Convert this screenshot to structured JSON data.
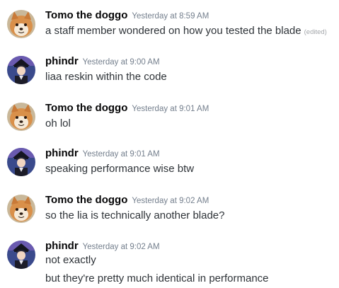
{
  "messages": [
    {
      "username": "Tomo the doggo",
      "timestamp": "Yesterday at 8:59 AM",
      "avatar": "shiba-dog-avatar",
      "lines": [
        "a staff member wondered on how you tested the blade"
      ],
      "edited_label": "(edited)"
    },
    {
      "username": "phindr",
      "timestamp": "Yesterday at 9:00 AM",
      "avatar": "anime-character-avatar",
      "lines": [
        "liaa reskin within the code"
      ]
    },
    {
      "username": "Tomo the doggo",
      "timestamp": "Yesterday at 9:01 AM",
      "avatar": "shiba-dog-avatar",
      "lines": [
        "oh lol"
      ]
    },
    {
      "username": "phindr",
      "timestamp": "Yesterday at 9:01 AM",
      "avatar": "anime-character-avatar",
      "lines": [
        "speaking performance wise btw"
      ]
    },
    {
      "username": "Tomo the doggo",
      "timestamp": "Yesterday at 9:02 AM",
      "avatar": "shiba-dog-avatar",
      "lines": [
        "so the lia is technically another blade?"
      ]
    },
    {
      "username": "phindr",
      "timestamp": "Yesterday at 9:02 AM",
      "avatar": "anime-character-avatar",
      "lines": [
        "not exactly",
        "but they're pretty much identical in performance"
      ]
    }
  ],
  "colors": {
    "background": "#ffffff",
    "username": "#060607",
    "message_text": "#2e3338",
    "timestamp": "#747f8d",
    "edited": "#a3a6aa"
  }
}
